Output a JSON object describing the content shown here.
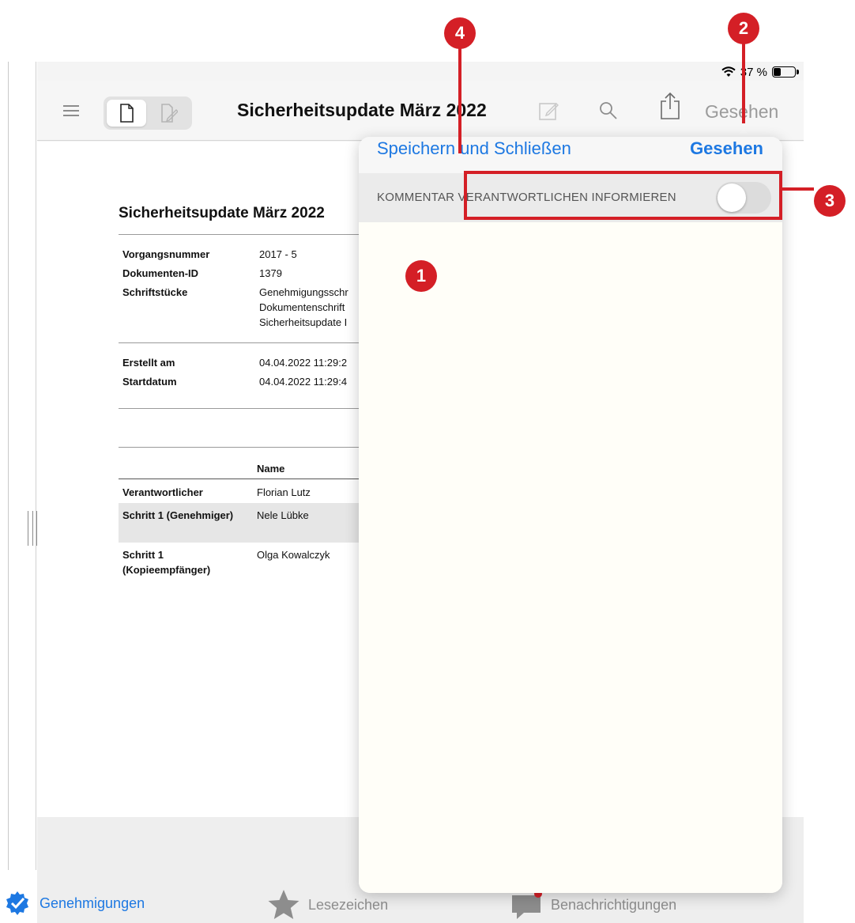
{
  "status_bar": {
    "battery_text": "37 %"
  },
  "navbar": {
    "title": "Sicherheitsupdate März 2022",
    "seen_label": "Gesehen"
  },
  "document": {
    "title": "Sicherheitsupdate März 2022",
    "meta": [
      {
        "key": "Vorgangsnummer",
        "value": "2017 - 5"
      },
      {
        "key": "Dokumenten-ID",
        "value": "1379"
      },
      {
        "key": "Schriftstücke",
        "value": [
          "Genehmigungsschr",
          "Dokumentenschrift",
          "Sicherheitsupdate I"
        ]
      }
    ],
    "dates": [
      {
        "key": "Erstellt am",
        "value": "04.04.2022 11:29:2"
      },
      {
        "key": "Startdatum",
        "value": "04.04.2022 11:29:4"
      }
    ],
    "table": {
      "header": "Name",
      "rows": [
        {
          "role": "Verantwortlicher",
          "name": "Florian Lutz"
        },
        {
          "role": "Schritt 1 (Genehmiger)",
          "name": "Nele Lübke"
        },
        {
          "role": [
            "Schritt 1",
            "(Kopieempfänger)"
          ],
          "name": "Olga Kowalczyk"
        }
      ]
    }
  },
  "popover": {
    "save_label": "Speichern und Schließen",
    "done_label": "Gesehen",
    "toggle_label": "KOMMENTAR VERANTWORTLICHEN INFORMIEREN",
    "toggle_on": false
  },
  "tabbar": {
    "items": [
      {
        "label": "Genehmigungen",
        "icon": "approvals-gear-check-icon",
        "active": true
      },
      {
        "label": "Lesezeichen",
        "icon": "star-icon",
        "active": false
      },
      {
        "label": "Benachrichtigungen",
        "icon": "chat-bubble-icon",
        "active": false
      }
    ]
  },
  "markers": [
    "1",
    "2",
    "3",
    "4"
  ],
  "colors": {
    "accent": "#1d78e2",
    "annotation": "#d41f26"
  }
}
